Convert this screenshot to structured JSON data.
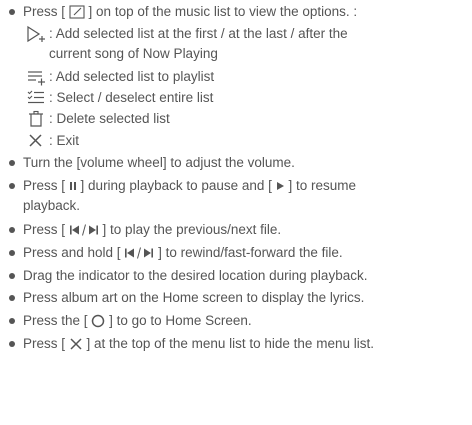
{
  "items": {
    "options": {
      "pre": "Press [",
      "post": "] on top of the music list to view the options. :"
    },
    "sub": {
      "add_now_playing_line1": ": Add selected list at the first / at the last / after the",
      "add_now_playing_line2": "current song of Now Playing",
      "add_playlist": ": Add selected list to playlist",
      "select_all": ": Select / deselect entire list",
      "delete": ": Delete selected list",
      "exit": ": Exit"
    },
    "volume": "Turn the [volume wheel] to adjust the volume.",
    "pause": {
      "pre": "Press [",
      "mid": "] during playback to pause and [",
      "post": "] to resume",
      "line2": "playback."
    },
    "prev_next": {
      "pre": "Press [",
      "post": "] to play the previous/next file."
    },
    "rewind": {
      "pre": "Press and hold [",
      "post": "] to rewind/fast-forward the file."
    },
    "drag": "Drag the indicator to the desired location during playback.",
    "album_art": "Press album art on the Home screen to display the lyrics.",
    "home": {
      "pre": "Press the [",
      "post": "] to go to Home Screen."
    },
    "hide_menu": {
      "pre": "Press [",
      "post": "] at the top of the menu list to hide the menu list."
    }
  },
  "icons": {
    "options": "edit-square-icon",
    "add_now_playing": "play-plus-icon",
    "add_playlist": "list-add-icon",
    "select_all": "checklist-icon",
    "delete": "trash-icon",
    "exit": "close-x-icon",
    "pause": "pause-icon",
    "play": "play-icon",
    "prev_next": "prev-next-icon",
    "home": "home-circle-icon",
    "hide_menu": "close-square-icon"
  },
  "colors": {
    "text": "#555555"
  }
}
